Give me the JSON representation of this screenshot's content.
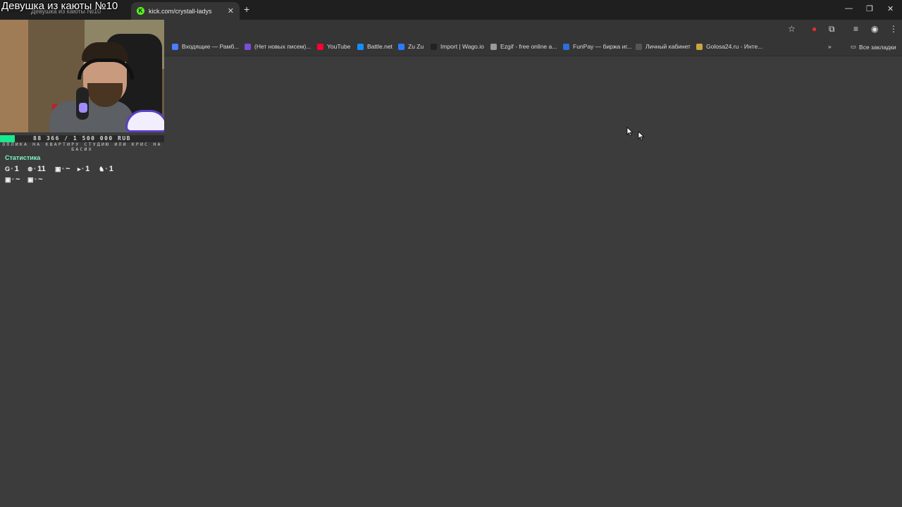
{
  "overlay": {
    "stream_title": "Девушка из каюты №10",
    "goal": {
      "text": "88 366 / 1 500 000 RUB",
      "progress": 0.059,
      "description": "ОПЛИКА НА КВАРТИРУ СТУДИЮ ИЛИ КРИС НА БАСИХ"
    },
    "stats": {
      "title": "Статистика",
      "row1": [
        {
          "icon": "G",
          "value": "1"
        },
        {
          "icon": "⊗",
          "value": "11"
        },
        {
          "icon": "▣",
          "value": "~"
        },
        {
          "icon": "▸",
          "value": "1"
        },
        {
          "icon": "♞",
          "value": "1"
        }
      ],
      "row2": [
        {
          "icon": "▣",
          "value": "~"
        },
        {
          "icon": "▣",
          "value": "~"
        }
      ]
    }
  },
  "browser": {
    "tabs": [
      {
        "label": "Девушка из каюты №10",
        "active": false
      },
      {
        "label": "kick.com/crystall-ladys",
        "active": true
      }
    ],
    "new_tab": "+",
    "window_controls": [
      "—",
      "❐",
      "✕"
    ],
    "bookmarks": [
      {
        "label": "Входящие — Рамб...",
        "color": "#4a7dff"
      },
      {
        "label": "(Нет новых писем)...",
        "color": "#7a4fd6"
      },
      {
        "label": "YouTube",
        "color": "#ff0033"
      },
      {
        "label": "Battle.net",
        "color": "#148eff"
      },
      {
        "label": "Zu Zu",
        "color": "#2a7cff"
      },
      {
        "label": "Import | Wago.io",
        "color": "#222222"
      },
      {
        "label": "Ezgif - free online a...",
        "color": "#9a9a9a"
      },
      {
        "label": "FunPay — биржа иг...",
        "color": "#2b6fd8"
      },
      {
        "label": "Личный кабинет",
        "color": "#555555"
      },
      {
        "label": "Golosa24.ru - Инте...",
        "color": "#c9a640"
      }
    ],
    "more_bookmarks": "»",
    "all_bookmarks": "Все закладки"
  }
}
